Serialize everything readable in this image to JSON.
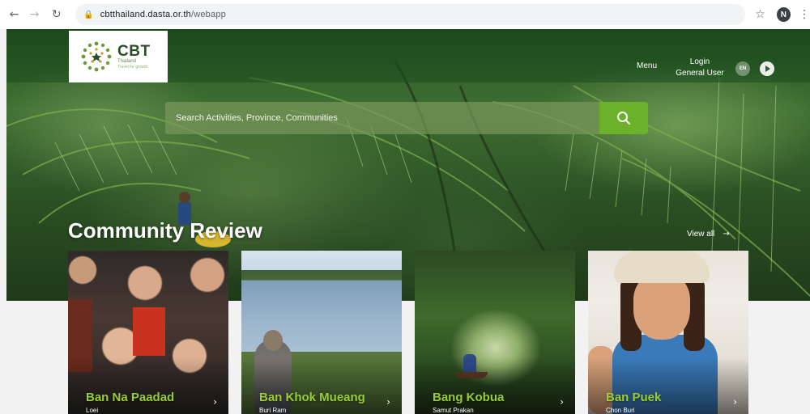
{
  "browser": {
    "url_host": "cbtthailand.dasta.or.th",
    "url_path": "/webapp",
    "profile_initial": "N"
  },
  "header": {
    "logo": {
      "title": "CBT",
      "subtitle": "Thailand",
      "tagline": "Travel for growth"
    },
    "menu_label": "Menu",
    "login_label": "Login",
    "user_label": "General User",
    "lang_label": "EN"
  },
  "search": {
    "placeholder": "Search Activities, Province, Communities"
  },
  "section": {
    "title": "Community Review",
    "view_all_label": "View all"
  },
  "cards": [
    {
      "name": "Ban Na Paadad",
      "province": "Loei"
    },
    {
      "name": "Ban Khok Mueang",
      "province": "Buri Ram"
    },
    {
      "name": "Bang Kobua",
      "province": "Samut Prakan"
    },
    {
      "name": "Ban Puek",
      "province": "Chon Buri"
    }
  ],
  "colors": {
    "accent_green": "#6bb22a",
    "card_title_green": "#9acd32",
    "logo_green": "#2a4d2a"
  }
}
